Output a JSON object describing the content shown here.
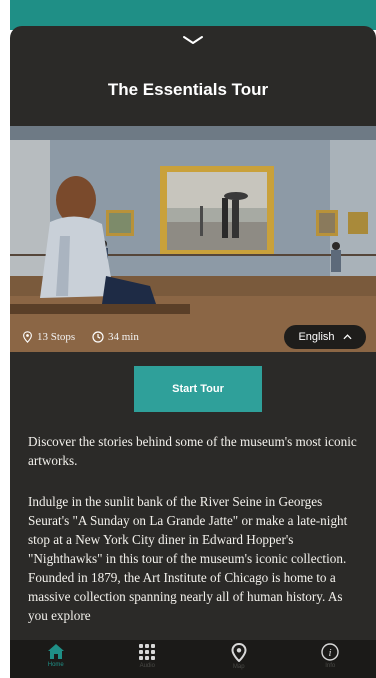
{
  "tour": {
    "title": "The Essentials Tour",
    "stops": "13 Stops",
    "duration": "34 min",
    "language": "English",
    "start_label": "Start Tour",
    "description_intro": "Discover the stories behind some of the museum's most iconic artworks.",
    "description_body": "Indulge in the sunlit bank of the River Seine in Georges Seurat's \"A Sunday on La Grande Jatte\" or make a late-night stop at a New York City diner in Edward Hopper's \"Nighthawks\" in this tour of the museum's iconic collection. Founded in 1879, the Art Institute of Chicago is home to a massive collection spanning nearly all of human history. As you explore"
  },
  "tabs": [
    {
      "label": "Home",
      "icon": "home-icon",
      "active": true
    },
    {
      "label": "Audio",
      "icon": "keypad-icon",
      "active": false
    },
    {
      "label": "Map",
      "icon": "map-pin-icon",
      "active": false
    },
    {
      "label": "Info",
      "icon": "info-icon",
      "active": false
    }
  ],
  "colors": {
    "accent": "#2fa09a",
    "sheet_bg": "#2b2a28",
    "tabbar_bg": "#1b1a18"
  }
}
